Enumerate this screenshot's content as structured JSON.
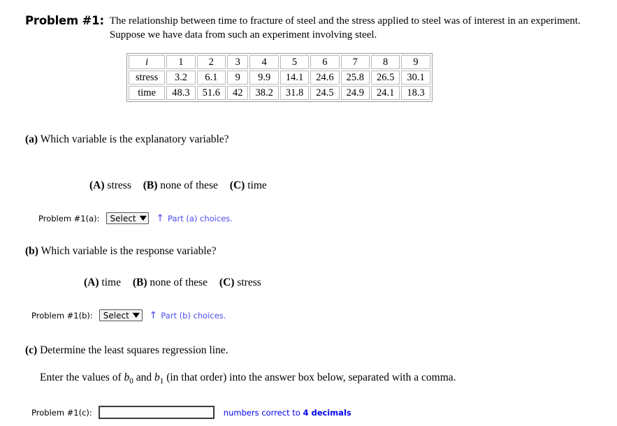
{
  "problem": {
    "label": "Problem #1:",
    "statement_line1": "The relationship between time to fracture of steel and the stress applied to steel was of interest in an experiment.",
    "statement_line2": "Suppose we have data from such an experiment involving steel."
  },
  "data_table": {
    "row_headers": [
      "i",
      "stress",
      "time"
    ],
    "index": [
      "1",
      "2",
      "3",
      "4",
      "5",
      "6",
      "7",
      "8",
      "9"
    ],
    "stress": [
      "3.2",
      "6.1",
      "9",
      "9.9",
      "14.1",
      "24.6",
      "25.8",
      "26.5",
      "30.1"
    ],
    "time": [
      "48.3",
      "51.6",
      "42",
      "38.2",
      "31.8",
      "24.5",
      "24.9",
      "24.1",
      "18.3"
    ]
  },
  "parts": {
    "a": {
      "label": "(a)",
      "question": "Which variable is the explanatory variable?",
      "choices": [
        {
          "key": "(A)",
          "text": "stress"
        },
        {
          "key": "(B)",
          "text": "none of these"
        },
        {
          "key": "(C)",
          "text": "time"
        }
      ],
      "answer_label": "Problem #1(a):",
      "select_value": "Select",
      "hint": "Part (a) choices."
    },
    "b": {
      "label": "(b)",
      "question": "Which variable is the response variable?",
      "choices": [
        {
          "key": "(A)",
          "text": "time"
        },
        {
          "key": "(B)",
          "text": "none of these"
        },
        {
          "key": "(C)",
          "text": "stress"
        }
      ],
      "answer_label": "Problem #1(b):",
      "select_value": "Select",
      "hint": "Part (b) choices."
    },
    "c": {
      "label": "(c)",
      "question": "Determine the least squares regression line.",
      "instruction_prefix": "Enter the values of ",
      "var_b0": "b",
      "var_b0_sub": "0",
      "instruction_mid": " and ",
      "var_b1": "b",
      "var_b1_sub": "1",
      "instruction_suffix": " (in that order) into the answer box below, separated with a comma.",
      "answer_label": "Problem #1(c):",
      "input_value": "",
      "note_prefix": "numbers correct to ",
      "note_bold": "4 decimals"
    }
  },
  "icons": {
    "chevron_down": "⌄",
    "up_arrow": "↑"
  },
  "colors": {
    "hint_link": "#4a4aef",
    "note_blue": "#0000ee",
    "table_border": "#9a9a9a"
  }
}
